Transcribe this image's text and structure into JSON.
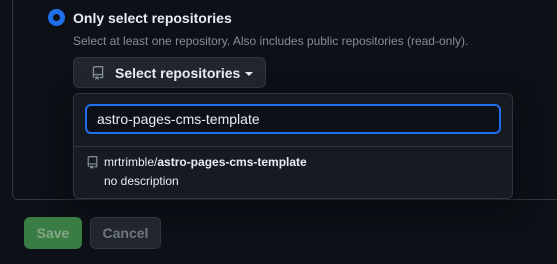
{
  "access": {
    "option_label": "Only select repositories",
    "option_help": "Select at least one repository. Also includes public repositories (read-only).",
    "select_button_label": "Select repositories"
  },
  "popover": {
    "filter_value": "astro-pages-cms-template",
    "results": [
      {
        "owner": "mrtrimble/",
        "repo": "astro-pages-cms-template",
        "description": "no description",
        "icon": "repo-icon"
      }
    ]
  },
  "actions": {
    "save_label": "Save",
    "cancel_label": "Cancel"
  },
  "colors": {
    "background": "#0d1117",
    "accent": "#1f6feb",
    "save_green": "#4aa254",
    "muted_text": "#848d97"
  }
}
